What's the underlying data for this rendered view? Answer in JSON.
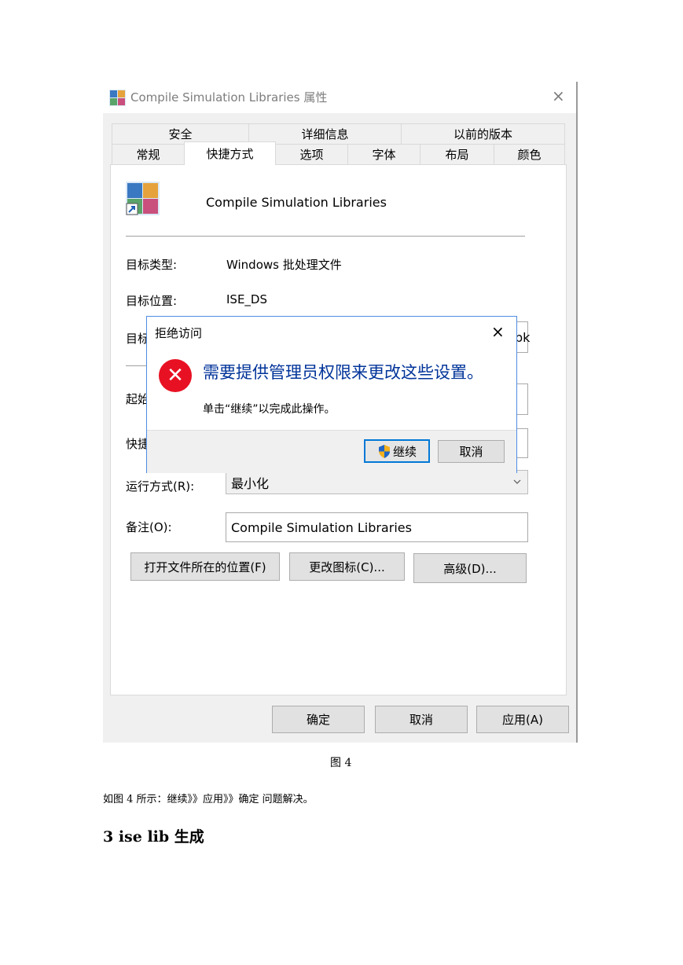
{
  "window": {
    "title": "Compile Simulation Libraries 属性",
    "close_glyph": "×"
  },
  "tabs_row1": [
    "安全",
    "详细信息",
    "以前的版本"
  ],
  "tabs_row2": [
    "常规",
    "快捷方式",
    "选项",
    "字体",
    "布局",
    "颜色"
  ],
  "shortcut": {
    "name": "Compile Simulation Libraries",
    "target_type_label": "目标类型:",
    "target_type_value": "Windows 批处理文件",
    "target_location_label": "目标位置:",
    "target_location_value": "ISE_DS",
    "target_label_cut": "目标",
    "target_value_cut": "bk",
    "start_label_cut": "起始",
    "hotkey_label_cut": "快捷",
    "run_label": "运行方式(R):",
    "run_value": "最小化",
    "comment_label": "备注(O):",
    "comment_value": "Compile Simulation Libraries",
    "buttons": [
      "打开文件所在的位置(F)",
      "更改图标(C)...",
      "高级(D)..."
    ]
  },
  "footer_buttons": [
    "确定",
    "取消",
    "应用(A)"
  ],
  "dialog": {
    "title": "拒绝访问",
    "message": "需要提供管理员权限来更改这些设置。",
    "sub": "单击“继续”以完成此操作。",
    "continue": "继续",
    "cancel": "取消",
    "close_glyph": "×",
    "error_glyph": "✕"
  },
  "doc": {
    "caption": "图 4",
    "paragraph": "如图 4 所示：继续》》应用》》确定   问题解决。",
    "heading": "3 ise lib 生成"
  },
  "colors": {
    "dialog_border": "#4e8de3",
    "error_red": "#e81123",
    "message_blue": "#003399"
  }
}
